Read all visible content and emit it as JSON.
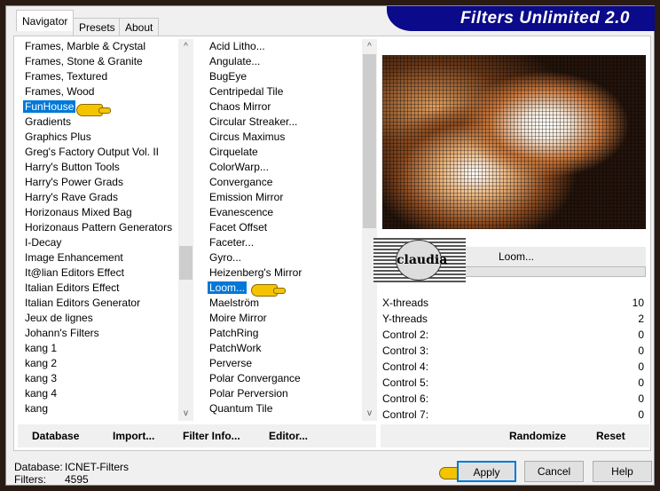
{
  "title": "Filters Unlimited 2.0",
  "tabs": [
    "Navigator",
    "Presets",
    "About"
  ],
  "categories": [
    "Frames, Marble & Crystal",
    "Frames, Stone & Granite",
    "Frames, Textured",
    "Frames, Wood",
    "FunHouse",
    "Gradients",
    "Graphics Plus",
    "Greg's Factory Output Vol. II",
    "Harry's Button Tools",
    "Harry's Power Grads",
    "Harry's Rave Grads",
    "Horizonaus Mixed Bag",
    "Horizonaus Pattern Generators",
    "I-Decay",
    "Image Enhancement",
    "It@lian Editors Effect",
    "Italian Editors Effect",
    "Italian Editors Generator",
    "Jeux de lignes",
    "Johann's Filters",
    "kang 1",
    "kang 2",
    "kang 3",
    "kang 4",
    "kang"
  ],
  "selected_category": "FunHouse",
  "filters": [
    "Acid Litho...",
    "Angulate...",
    "BugEye",
    "Centripedal Tile",
    "Chaos Mirror",
    "Circular Streaker...",
    "Circus Maximus",
    "Cirquelate",
    "ColorWarp...",
    "Convergance",
    "Emission Mirror",
    "Evanescence",
    "Facet Offset",
    "Faceter...",
    "Gyro...",
    "Heizenberg's Mirror",
    "Loom...",
    "Maelström",
    "Moire Mirror",
    "PatchRing",
    "PatchWork",
    "Perverse",
    "Polar Convergance",
    "Polar Perversion",
    "Quantum Tile"
  ],
  "selected_filter": "Loom...",
  "filter_name": "Loom...",
  "watermark": "claudia",
  "controls": [
    {
      "label": "X-threads",
      "value": "10"
    },
    {
      "label": "Y-threads",
      "value": "2"
    },
    {
      "label": "Control 2:",
      "value": "0"
    },
    {
      "label": "Control 3:",
      "value": "0"
    },
    {
      "label": "Control 4:",
      "value": "0"
    },
    {
      "label": "Control 5:",
      "value": "0"
    },
    {
      "label": "Control 6:",
      "value": "0"
    },
    {
      "label": "Control 7:",
      "value": "0"
    }
  ],
  "toolbar": {
    "database": "Database",
    "import": "Import...",
    "filter_info": "Filter Info...",
    "editor": "Editor...",
    "randomize": "Randomize",
    "reset": "Reset"
  },
  "status": {
    "database_label": "Database:",
    "database_value": "ICNET-Filters",
    "filters_label": "Filters:",
    "filters_value": "4595"
  },
  "buttons": {
    "apply": "Apply",
    "cancel": "Cancel",
    "help": "Help"
  }
}
